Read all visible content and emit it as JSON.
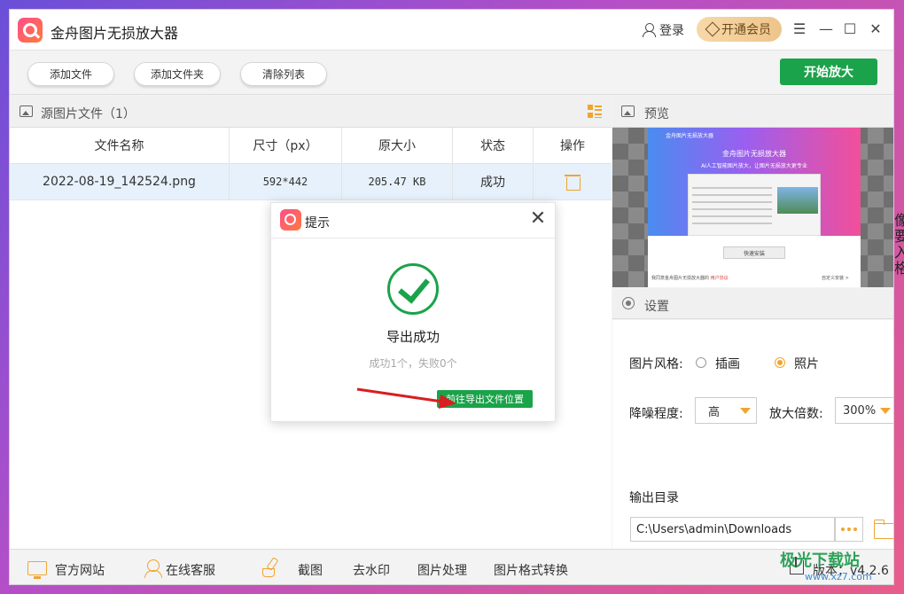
{
  "titlebar": {
    "app_title": "金舟图片无损放大器",
    "login": "登录",
    "vip": "开通会员",
    "menu_icon": "☰",
    "minimize_icon": "—",
    "maximize_icon": "☐",
    "close_icon": "✕"
  },
  "toolbar": {
    "add_file": "添加文件",
    "add_folder": "添加文件夹",
    "clear_list": "清除列表",
    "start": "开始放大"
  },
  "file_panel": {
    "title": "源图片文件（1）",
    "columns": [
      "文件名称",
      "尺寸（px）",
      "原大小",
      "状态",
      "操作"
    ],
    "rows": [
      {
        "name": "2022-08-19_142524.png",
        "size": "592*442",
        "orig": "205.47 KB",
        "status": "成功"
      }
    ]
  },
  "preview": {
    "title": "预览",
    "mini_app_title": "金舟图片无损放大器",
    "mini_headline": "金舟图片无损放大器",
    "mini_subline": "AI人工智能图片放大，让图片无损放大更专业",
    "mini_install": "快速安装",
    "mini_agree": "我同意金舟图片无损放大器的",
    "mini_agree_link": "用户协议",
    "mini_custom": "自定义安装 >"
  },
  "settings": {
    "title": "设置",
    "style_label": "图片风格:",
    "style_options": [
      "插画",
      "照片"
    ],
    "style_selected": "照片",
    "denoise_label": "降噪程度:",
    "denoise_value": "高",
    "scale_label": "放大倍数:",
    "scale_value": "300%",
    "output_label": "输出目录",
    "output_path": "C:\\Users\\admin\\Downloads"
  },
  "dialog": {
    "title": "提示",
    "message": "导出成功",
    "detail": "成功1个，失败0个",
    "open_folder": "前往导出文件位置",
    "close_icon": "✕"
  },
  "bottombar": {
    "website": "官方网站",
    "support": "在线客服",
    "screenshot": "截图",
    "watermark_remove": "去水印",
    "image_process": "图片处理",
    "format_convert": "图片格式转换",
    "version": "版本：v4.2.6"
  },
  "overlay": {
    "site_logo": "极光下载站",
    "site_url": "www.xz7.com",
    "bleed_chars": "像 要 入 格"
  },
  "colors": {
    "accent_green": "#1aa34a",
    "accent_orange": "#f0a52e",
    "arrow_red": "#d81e1e"
  }
}
